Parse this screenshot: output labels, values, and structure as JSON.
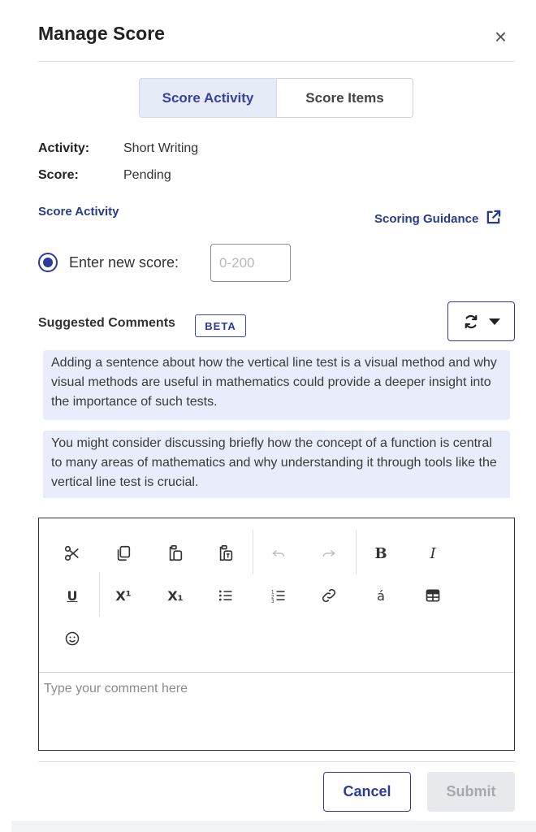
{
  "dialog": {
    "title": "Manage Score",
    "close_glyph": "×"
  },
  "tabs": [
    {
      "label": "Score Activity",
      "active": true
    },
    {
      "label": "Score Items",
      "active": false
    }
  ],
  "info": {
    "activity_label": "Activity:",
    "activity_value": "Short Writing",
    "score_label": "Score:",
    "score_value": "Pending"
  },
  "score_activity_link": "Score Activity",
  "scoring_guidance_link": "Scoring Guidance",
  "score_entry": {
    "radio_label": "Enter new score:",
    "placeholder": "0-200",
    "selected": true
  },
  "suggested": {
    "label": "Suggested Comments",
    "badge": "BETA",
    "comments": [
      "Adding a sentence about how the vertical line test is a visual method and why visual methods are useful in mathematics could provide a deeper insight into the importance of such tests.",
      "You might consider discussing briefly how the concept of a function is central to many areas of mathematics and why understanding it through tools like the vertical line test is crucial."
    ]
  },
  "editor": {
    "placeholder": "Type your comment here",
    "tools": [
      {
        "name": "cut-icon",
        "glyph": "✂",
        "enabled": true
      },
      {
        "name": "copy-icon",
        "glyph": "",
        "enabled": true
      },
      {
        "name": "paste-icon",
        "glyph": "",
        "enabled": true
      },
      {
        "name": "paste-text-icon",
        "glyph": "",
        "enabled": true
      },
      {
        "name": "undo-icon",
        "glyph": "↶",
        "enabled": false
      },
      {
        "name": "redo-icon",
        "glyph": "↷",
        "enabled": false
      },
      {
        "name": "bold-icon",
        "glyph": "B",
        "enabled": true
      },
      {
        "name": "italic-icon",
        "glyph": "I",
        "enabled": true
      },
      {
        "name": "underline-icon",
        "glyph": "U",
        "enabled": true
      },
      {
        "name": "superscript-icon",
        "glyph": "X¹",
        "enabled": true
      },
      {
        "name": "subscript-icon",
        "glyph": "X₁",
        "enabled": true
      },
      {
        "name": "bulleted-list-icon",
        "glyph": "",
        "enabled": true
      },
      {
        "name": "numbered-list-icon",
        "glyph": "",
        "enabled": true
      },
      {
        "name": "link-icon",
        "glyph": "",
        "enabled": true
      },
      {
        "name": "special-character-icon",
        "glyph": "á",
        "enabled": true
      },
      {
        "name": "table-icon",
        "glyph": "",
        "enabled": true
      },
      {
        "name": "emoji-icon",
        "glyph": "☺",
        "enabled": true
      }
    ]
  },
  "footer": {
    "cancel_label": "Cancel",
    "submit_label": "Submit"
  },
  "colors": {
    "accent": "#2c3a9c",
    "tab_active_bg": "#e6ebf8",
    "comment_bg": "#e8ecfb",
    "submit_disabled_bg": "#e8e9ec"
  }
}
